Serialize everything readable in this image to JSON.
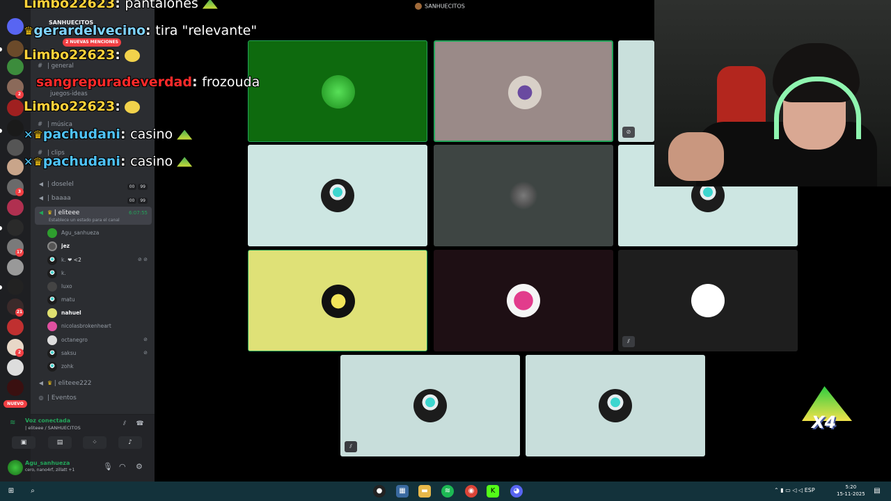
{
  "colors": {
    "accent_green": "#23a55a",
    "mention_red": "#f23f43",
    "sidebar_bg": "#2b2d31",
    "rail_bg": "#1e1f22",
    "taskbar_bg": "#13323b"
  },
  "server": {
    "name": "SANHUECITOS",
    "mentions_badge": "2 NUEVAS MENCIONES",
    "new_badge": "NUEVO"
  },
  "channels": [
    {
      "name": "| general",
      "icon": "hash-icon"
    },
    {
      "name": "juegos-ideas",
      "icon": "hash-icon"
    },
    {
      "name": "| música",
      "icon": "music-icon"
    },
    {
      "name": "| clips",
      "icon": "hash-icon"
    }
  ],
  "voice_channels": [
    {
      "name": "| doselel",
      "count_a": "00",
      "count_b": "99"
    },
    {
      "name": "| baaaa",
      "count_a": "00",
      "count_b": "99"
    }
  ],
  "active_voice": {
    "name": "| eliteee",
    "timer": "6:07:55",
    "status": "Establece un estado para el canal"
  },
  "members": [
    {
      "name": "Agu_sanhueza",
      "online": false
    },
    {
      "name": "jez",
      "online": true
    },
    {
      "name": "k.",
      "online": false,
      "extra": "❤ <2"
    },
    {
      "name": "k.",
      "online": false
    },
    {
      "name": "luxo",
      "online": false
    },
    {
      "name": "matu",
      "online": false
    },
    {
      "name": "nahuel",
      "online": true
    },
    {
      "name": "nicolasbrokenheart",
      "online": false
    },
    {
      "name": "octanegro",
      "online": false
    },
    {
      "name": "saksu",
      "online": false
    },
    {
      "name": "zohk",
      "online": false
    }
  ],
  "other_voice": {
    "name": "| eliteee222"
  },
  "events_label": "| Eventos",
  "voice_panel": {
    "connected": "Voz conectada",
    "channel": "| eliteee / SANHUECITOS"
  },
  "user": {
    "name": "Agu_sanhueza",
    "status": "cero, nano4rf, zillatt +1"
  },
  "server_badges": [
    "2",
    "3",
    "17",
    "21",
    "2",
    "2"
  ],
  "stage": {
    "title": "SANHUECITOS"
  },
  "chat": [
    {
      "user": "Limbo22623",
      "text": "pantalones"
    },
    {
      "user": "gerardelvecino",
      "text": "tira \"relevante\""
    },
    {
      "user": "Limbo22623",
      "text": ""
    },
    {
      "user": "sangrepuradeverdad",
      "text": "frozouda"
    },
    {
      "user": "Limbo22623",
      "text": ""
    },
    {
      "user": "pachudani",
      "text": "casino"
    },
    {
      "user": "pachudani",
      "text": "casino"
    }
  ],
  "overlay_badge": "X4",
  "taskbar": {
    "lang": "ESP",
    "time": "5:20",
    "date": "15-11-2025"
  }
}
